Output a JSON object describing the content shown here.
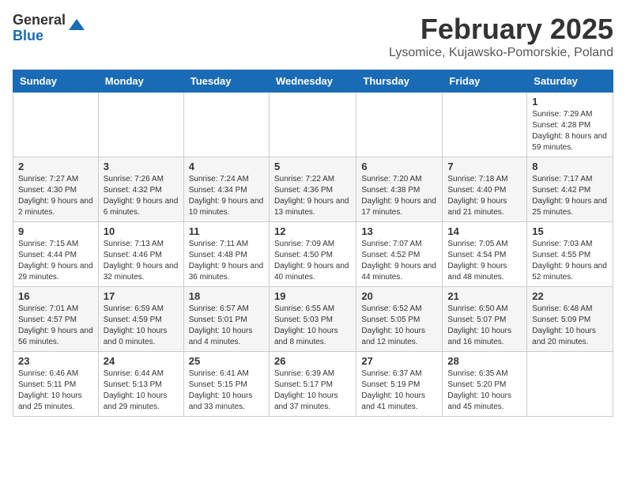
{
  "header": {
    "logo_general": "General",
    "logo_blue": "Blue",
    "month_year": "February 2025",
    "location": "Lysomice, Kujawsko-Pomorskie, Poland"
  },
  "days_of_week": [
    "Sunday",
    "Monday",
    "Tuesday",
    "Wednesday",
    "Thursday",
    "Friday",
    "Saturday"
  ],
  "weeks": [
    [
      {
        "day": "",
        "info": ""
      },
      {
        "day": "",
        "info": ""
      },
      {
        "day": "",
        "info": ""
      },
      {
        "day": "",
        "info": ""
      },
      {
        "day": "",
        "info": ""
      },
      {
        "day": "",
        "info": ""
      },
      {
        "day": "1",
        "info": "Sunrise: 7:29 AM\nSunset: 4:28 PM\nDaylight: 8 hours and 59 minutes."
      }
    ],
    [
      {
        "day": "2",
        "info": "Sunrise: 7:27 AM\nSunset: 4:30 PM\nDaylight: 9 hours and 2 minutes."
      },
      {
        "day": "3",
        "info": "Sunrise: 7:26 AM\nSunset: 4:32 PM\nDaylight: 9 hours and 6 minutes."
      },
      {
        "day": "4",
        "info": "Sunrise: 7:24 AM\nSunset: 4:34 PM\nDaylight: 9 hours and 10 minutes."
      },
      {
        "day": "5",
        "info": "Sunrise: 7:22 AM\nSunset: 4:36 PM\nDaylight: 9 hours and 13 minutes."
      },
      {
        "day": "6",
        "info": "Sunrise: 7:20 AM\nSunset: 4:38 PM\nDaylight: 9 hours and 17 minutes."
      },
      {
        "day": "7",
        "info": "Sunrise: 7:18 AM\nSunset: 4:40 PM\nDaylight: 9 hours and 21 minutes."
      },
      {
        "day": "8",
        "info": "Sunrise: 7:17 AM\nSunset: 4:42 PM\nDaylight: 9 hours and 25 minutes."
      }
    ],
    [
      {
        "day": "9",
        "info": "Sunrise: 7:15 AM\nSunset: 4:44 PM\nDaylight: 9 hours and 29 minutes."
      },
      {
        "day": "10",
        "info": "Sunrise: 7:13 AM\nSunset: 4:46 PM\nDaylight: 9 hours and 32 minutes."
      },
      {
        "day": "11",
        "info": "Sunrise: 7:11 AM\nSunset: 4:48 PM\nDaylight: 9 hours and 36 minutes."
      },
      {
        "day": "12",
        "info": "Sunrise: 7:09 AM\nSunset: 4:50 PM\nDaylight: 9 hours and 40 minutes."
      },
      {
        "day": "13",
        "info": "Sunrise: 7:07 AM\nSunset: 4:52 PM\nDaylight: 9 hours and 44 minutes."
      },
      {
        "day": "14",
        "info": "Sunrise: 7:05 AM\nSunset: 4:54 PM\nDaylight: 9 hours and 48 minutes."
      },
      {
        "day": "15",
        "info": "Sunrise: 7:03 AM\nSunset: 4:55 PM\nDaylight: 9 hours and 52 minutes."
      }
    ],
    [
      {
        "day": "16",
        "info": "Sunrise: 7:01 AM\nSunset: 4:57 PM\nDaylight: 9 hours and 56 minutes."
      },
      {
        "day": "17",
        "info": "Sunrise: 6:59 AM\nSunset: 4:59 PM\nDaylight: 10 hours and 0 minutes."
      },
      {
        "day": "18",
        "info": "Sunrise: 6:57 AM\nSunset: 5:01 PM\nDaylight: 10 hours and 4 minutes."
      },
      {
        "day": "19",
        "info": "Sunrise: 6:55 AM\nSunset: 5:03 PM\nDaylight: 10 hours and 8 minutes."
      },
      {
        "day": "20",
        "info": "Sunrise: 6:52 AM\nSunset: 5:05 PM\nDaylight: 10 hours and 12 minutes."
      },
      {
        "day": "21",
        "info": "Sunrise: 6:50 AM\nSunset: 5:07 PM\nDaylight: 10 hours and 16 minutes."
      },
      {
        "day": "22",
        "info": "Sunrise: 6:48 AM\nSunset: 5:09 PM\nDaylight: 10 hours and 20 minutes."
      }
    ],
    [
      {
        "day": "23",
        "info": "Sunrise: 6:46 AM\nSunset: 5:11 PM\nDaylight: 10 hours and 25 minutes."
      },
      {
        "day": "24",
        "info": "Sunrise: 6:44 AM\nSunset: 5:13 PM\nDaylight: 10 hours and 29 minutes."
      },
      {
        "day": "25",
        "info": "Sunrise: 6:41 AM\nSunset: 5:15 PM\nDaylight: 10 hours and 33 minutes."
      },
      {
        "day": "26",
        "info": "Sunrise: 6:39 AM\nSunset: 5:17 PM\nDaylight: 10 hours and 37 minutes."
      },
      {
        "day": "27",
        "info": "Sunrise: 6:37 AM\nSunset: 5:19 PM\nDaylight: 10 hours and 41 minutes."
      },
      {
        "day": "28",
        "info": "Sunrise: 6:35 AM\nSunset: 5:20 PM\nDaylight: 10 hours and 45 minutes."
      },
      {
        "day": "",
        "info": ""
      }
    ]
  ]
}
